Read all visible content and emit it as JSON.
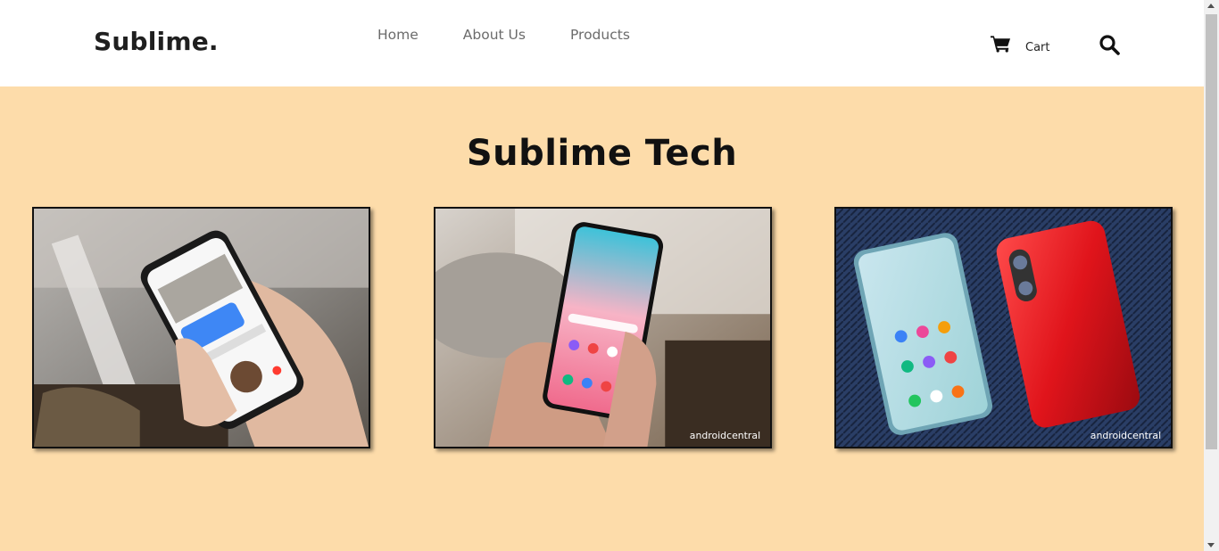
{
  "header": {
    "logo": "Sublime.",
    "nav": [
      {
        "label": "Home"
      },
      {
        "label": "About Us"
      },
      {
        "label": "Products"
      }
    ],
    "cart_label": "Cart",
    "icons": {
      "cart": "shopping-cart-icon",
      "search": "search-icon"
    }
  },
  "hero": {
    "title": "Sublime Tech",
    "background_color": "#fddcaa"
  },
  "products": [
    {
      "image": "iphone-in-hand-photo"
    },
    {
      "image": "galaxy-s10-in-hand-photo",
      "watermark": "androidcentral"
    },
    {
      "image": "huawei-p30-pair-photo",
      "watermark": "androidcentral"
    }
  ]
}
